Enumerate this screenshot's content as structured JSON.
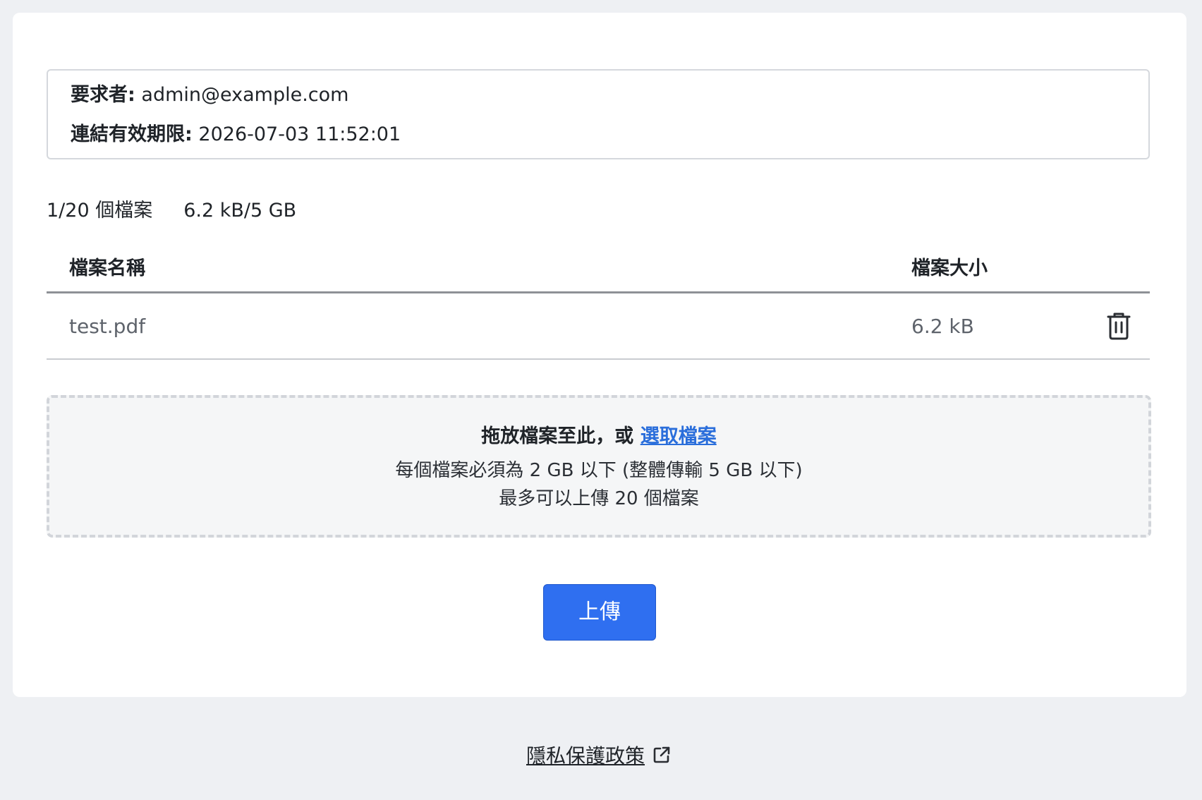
{
  "request_info": {
    "requester_label": "要求者:",
    "requester_value": "admin@example.com",
    "expiry_label": "連結有效期限:",
    "expiry_value": "2026-07-03 11:52:01"
  },
  "summary": {
    "file_count": "1/20 個檔案",
    "total_size": "6.2 kB/5 GB"
  },
  "file_table": {
    "columns": [
      "檔案名稱",
      "檔案大小"
    ],
    "rows": [
      {
        "name": "test.pdf",
        "size": "6.2 kB",
        "action_icon": "trash-icon"
      }
    ]
  },
  "dropzone": {
    "prompt": "拖放檔案至此，或",
    "link_label": "選取檔案",
    "limit_per_file": "每個檔案必須為 2 GB 以下 (整體傳輸 5 GB 以下)",
    "limit_count": "最多可以上傳 20 個檔案"
  },
  "actions": {
    "upload_label": "上傳"
  },
  "footer": {
    "privacy_label": "隱私保護政策",
    "privacy_icon": "external-link-icon"
  },
  "colors": {
    "accent": "#2f6ff0",
    "link": "#2a6edb",
    "page_background": "#eef0f3"
  }
}
